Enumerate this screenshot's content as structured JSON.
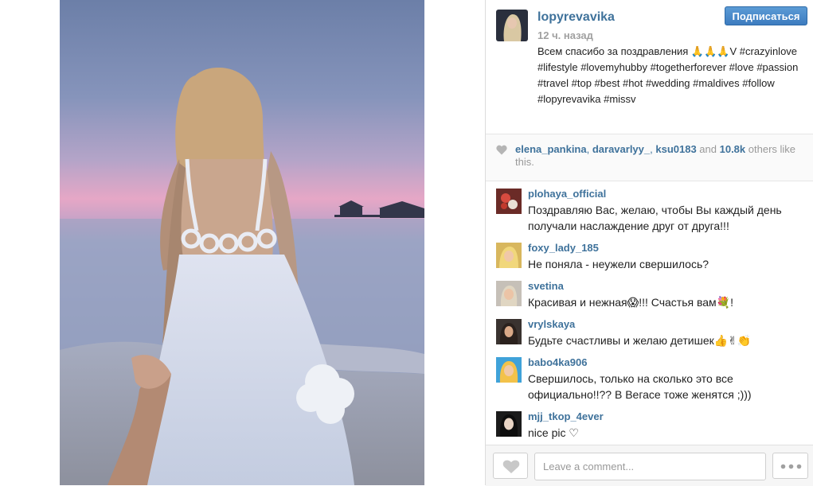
{
  "post": {
    "author": "lopyrevavika",
    "time": "12 ч. назад",
    "follow_label": "Подписаться",
    "caption": "Всем спасибо за поздравления 🙏🙏🙏V #crazyinlove #lifestyle #lovemyhubby #togetherforever #love #passion #travel #top #best #hot #wedding #maldives #follow #lopyrevavika #missv"
  },
  "likes": {
    "users": [
      "elena_pankina",
      "daravarlyy_",
      "ksu0183"
    ],
    "sep1": ", ",
    "sep2": ", ",
    "and": " and ",
    "count": "10.8k",
    "suffix": " others like this."
  },
  "comments": [
    {
      "user": "plohaya_official",
      "text": "Поздравляю Вас, желаю, чтобы Вы каждый день получали наслаждение друг от друга!!!"
    },
    {
      "user": "foxy_lady_185",
      "text": "Не поняла - неужели свершилось?"
    },
    {
      "user": "svetina",
      "text": "Красивая и нежная😱!!! Счастья вам💐!"
    },
    {
      "user": "vrylskaya",
      "text": "Будьте счастливы и желаю детишек👍✌👏"
    },
    {
      "user": "babo4ka906",
      "text": "Свершилось, только на сколько это все официально!!?? В Вегасе тоже женятся ;)))"
    },
    {
      "user": "mjj_tkop_4ever",
      "text": "nice pic ♡"
    }
  ],
  "footer": {
    "comment_placeholder": "Leave a comment..."
  },
  "icons": {
    "like": "heart-icon",
    "more": "more-dots-icon"
  }
}
